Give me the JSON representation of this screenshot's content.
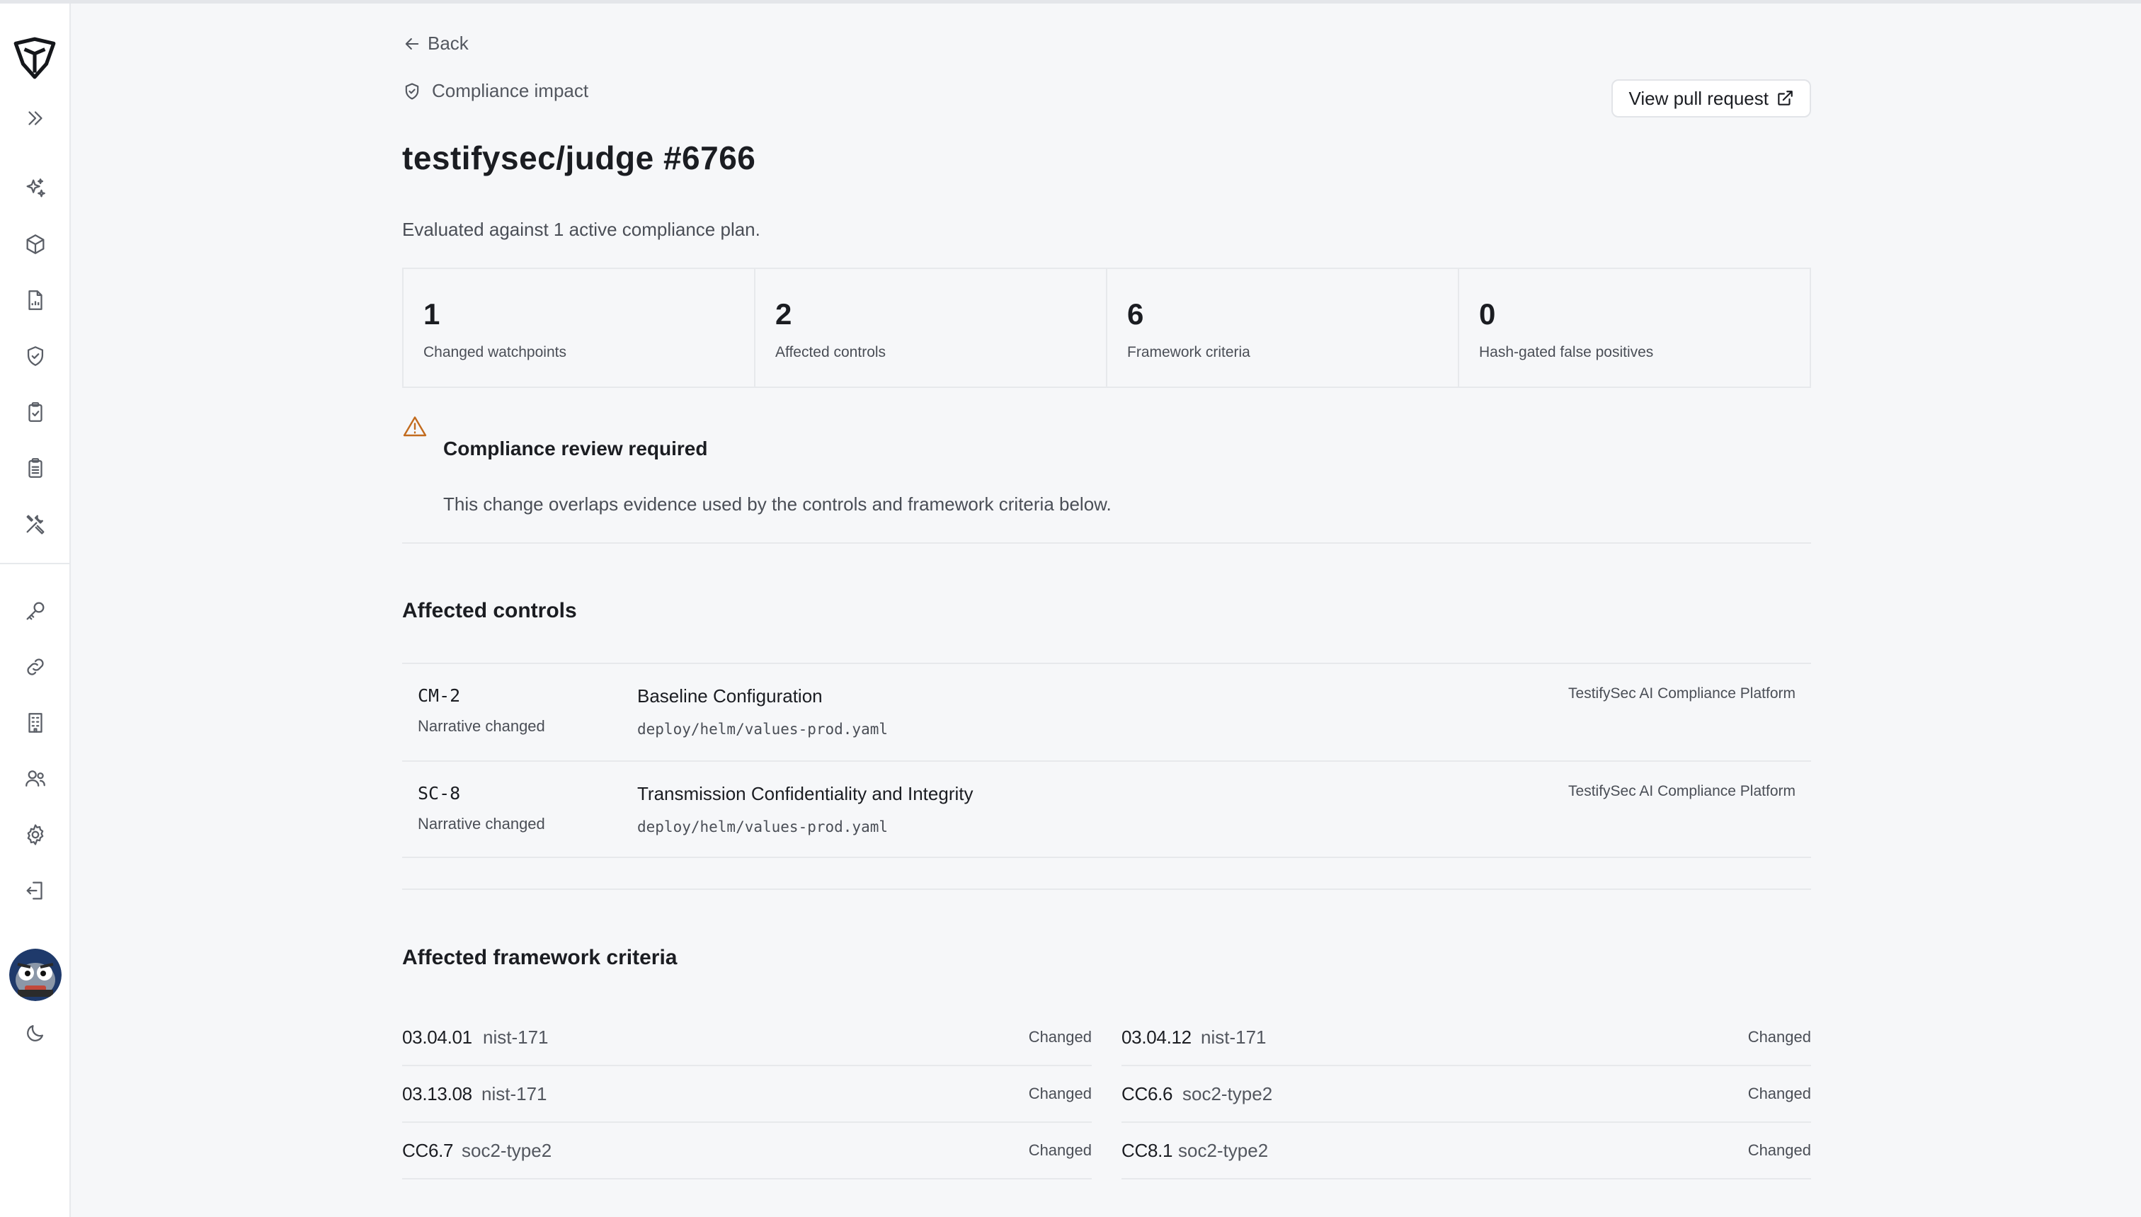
{
  "nav": {
    "back_label": "Back",
    "eyebrow": "Compliance impact",
    "pr_button": "View pull request"
  },
  "header": {
    "title": "testifysec/judge #6766",
    "subtitle": "Evaluated against 1 active compliance plan."
  },
  "stats": [
    {
      "value": "1",
      "label": "Changed watchpoints"
    },
    {
      "value": "2",
      "label": "Affected controls"
    },
    {
      "value": "6",
      "label": "Framework criteria"
    },
    {
      "value": "0",
      "label": "Hash-gated false positives"
    }
  ],
  "alert": {
    "title": "Compliance review required",
    "body": "This change overlaps evidence used by the controls and framework criteria below."
  },
  "controls": {
    "title": "Affected controls",
    "rows": [
      {
        "id": "CM-2",
        "status": "Narrative changed",
        "name": "Baseline Configuration",
        "path": "deploy/helm/values-prod.yaml",
        "platform": "TestifySec AI Compliance Platform"
      },
      {
        "id": "SC-8",
        "status": "Narrative changed",
        "name": "Transmission Confidentiality and Integrity",
        "path": "deploy/helm/values-prod.yaml",
        "platform": "TestifySec AI Compliance Platform"
      }
    ]
  },
  "criteria": {
    "title": "Affected framework criteria",
    "items": [
      {
        "id": "03.04.01",
        "framework": "nist-171",
        "status": "Changed"
      },
      {
        "id": "03.04.12",
        "framework": "nist-171",
        "status": "Changed"
      },
      {
        "id": "03.13.08",
        "framework": "nist-171",
        "status": "Changed"
      },
      {
        "id": "CC6.6",
        "framework": "soc2-type2",
        "status": "Changed"
      },
      {
        "id": "CC6.7",
        "framework": "soc2-type2",
        "status": "Changed"
      },
      {
        "id": "CC8.1",
        "framework": "soc2-type2",
        "status": "Changed"
      }
    ]
  },
  "sidebar": {
    "icons": [
      "logo-icon",
      "expand-icon",
      "sparkles-icon",
      "cube-icon",
      "document-chart-icon",
      "shield-check-icon",
      "clipboard-check-icon",
      "clipboard-list-icon",
      "tools-icon",
      "key-icon",
      "link-icon",
      "building-icon",
      "users-icon",
      "gear-icon",
      "logout-icon",
      "avatar",
      "moon-icon"
    ]
  },
  "colors": {
    "background": "#f6f7f9",
    "warning": "#c26b1e",
    "text": "#1b1d22",
    "muted": "#4a4e56"
  }
}
